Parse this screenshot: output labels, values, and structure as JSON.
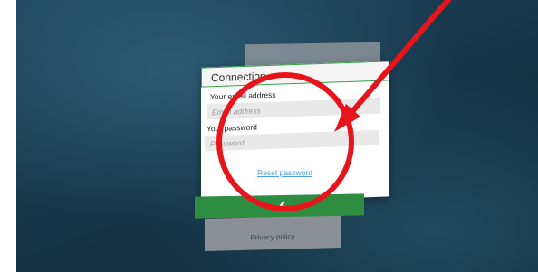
{
  "dialog": {
    "title": "Connection",
    "email_label": "Your email address",
    "email_placeholder": "Email address",
    "password_label": "Your password",
    "password_placeholder": "Password",
    "reset_link": "Reset password",
    "submit_icon": "check-icon"
  },
  "footer": {
    "privacy_link": "Privacy policy"
  },
  "annotation": {
    "color": "#e8141b",
    "shapes": [
      "arrow",
      "circle"
    ]
  },
  "colors": {
    "accent": "#2f8d41",
    "link": "#4a9ed9"
  }
}
